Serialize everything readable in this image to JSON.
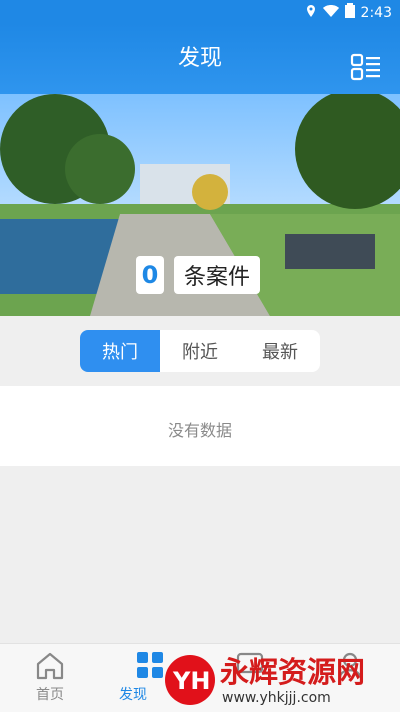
{
  "status": {
    "time": "2:43"
  },
  "header": {
    "title": "发现"
  },
  "banner": {
    "count": "0",
    "count_label": "条案件"
  },
  "tabs": [
    {
      "label": "热门",
      "active": true
    },
    {
      "label": "附近",
      "active": false
    },
    {
      "label": "最新",
      "active": false
    }
  ],
  "empty_message": "没有数据",
  "bottom_nav": [
    {
      "label": "首页",
      "icon": "home-icon"
    },
    {
      "label": "发现",
      "icon": "grid-icon",
      "active": true
    },
    {
      "label": "",
      "icon": "message-icon"
    },
    {
      "label": "",
      "icon": "user-icon"
    }
  ],
  "watermark": {
    "brand": "YH",
    "text": "永辉资源网",
    "url": "www.yhkjjj.com"
  },
  "colors": {
    "primary": "#1f88e5",
    "tab_active": "#2f8ff0",
    "background": "#efefef"
  }
}
